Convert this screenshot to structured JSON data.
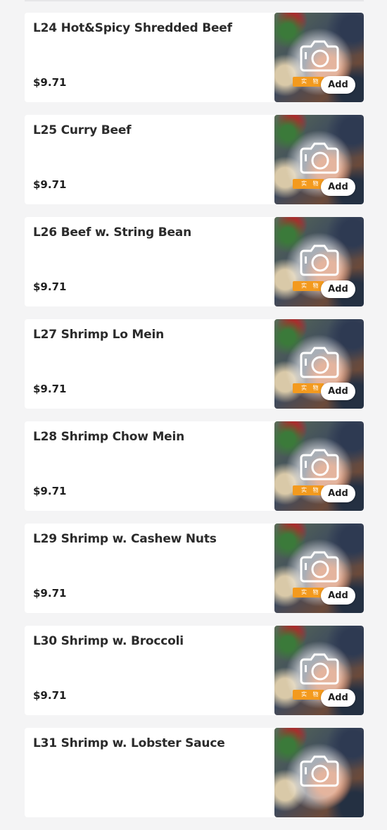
{
  "menu": {
    "items": [
      {
        "name": "L24 Hot&Spicy Shredded Beef",
        "price": "$9.71",
        "add_label": "Add",
        "image_badge": "实 物"
      },
      {
        "name": "L25 Curry Beef",
        "price": "$9.71",
        "add_label": "Add",
        "image_badge": "实 物"
      },
      {
        "name": "L26 Beef w. String Bean",
        "price": "$9.71",
        "add_label": "Add",
        "image_badge": "实 物"
      },
      {
        "name": "L27 Shrimp Lo Mein",
        "price": "$9.71",
        "add_label": "Add",
        "image_badge": "实 物"
      },
      {
        "name": "L28 Shrimp Chow Mein",
        "price": "$9.71",
        "add_label": "Add",
        "image_badge": "实 物"
      },
      {
        "name": "L29 Shrimp w. Cashew Nuts",
        "price": "$9.71",
        "add_label": "Add",
        "image_badge": "实 物"
      },
      {
        "name": "L30 Shrimp w. Broccoli",
        "price": "$9.71",
        "add_label": "Add",
        "image_badge": "实 物"
      },
      {
        "name": "L31 Shrimp w. Lobster Sauce",
        "price": "",
        "add_label": "",
        "image_badge": ""
      }
    ]
  },
  "icons": {
    "thumbnail_placeholder": "camera-icon"
  },
  "colors": {
    "page_background": "#f4f4f5",
    "card_background": "#ffffff",
    "badge_orange": "#f39a1e",
    "camera_outline": "#ffffff"
  }
}
